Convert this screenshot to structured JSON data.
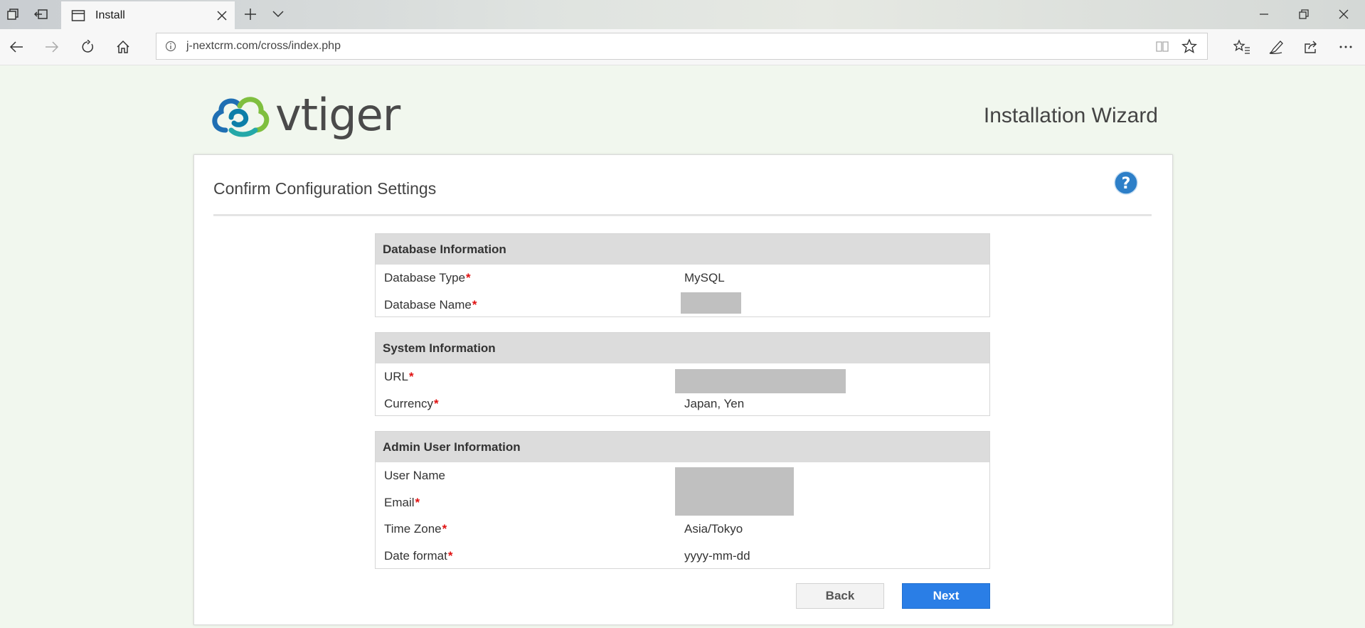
{
  "browser": {
    "tab_title": "Install",
    "address_url": "j-nextcrm.com/cross/index.php"
  },
  "header": {
    "logo_text": "vtiger",
    "wizard_title": "Installation Wizard"
  },
  "card": {
    "title": "Confirm Configuration Settings"
  },
  "sections": {
    "database": {
      "title": "Database Information",
      "rows": [
        {
          "label": "Database Type",
          "required": "*",
          "value": "MySQL"
        },
        {
          "label": "Database Name",
          "required": "*",
          "value": ""
        }
      ]
    },
    "system": {
      "title": "System Information",
      "rows": [
        {
          "label": "URL",
          "required": "*",
          "value": ""
        },
        {
          "label": "Currency",
          "required": "*",
          "value": "Japan, Yen"
        }
      ]
    },
    "admin": {
      "title": "Admin User Information",
      "rows": [
        {
          "label": "User Name",
          "required": "",
          "value": ""
        },
        {
          "label": "Email",
          "required": "*",
          "value": ""
        },
        {
          "label": "Time Zone",
          "required": "*",
          "value": "Asia/Tokyo"
        },
        {
          "label": "Date format",
          "required": "*",
          "value": "yyyy-mm-dd"
        }
      ]
    }
  },
  "buttons": {
    "back": "Back",
    "next": "Next"
  },
  "colors": {
    "page_bg": "#f1f7ee",
    "section_header_bg": "#dcdcdc",
    "required": "#e01010",
    "primary": "#2a7ee6",
    "help_icon": "#2d7fc8"
  },
  "icons": [
    "tab-manager-icon",
    "set-aside-tabs-icon",
    "tab-page-icon",
    "close-tab-icon",
    "new-tab-icon",
    "tab-dropdown-icon",
    "minimize-icon",
    "restore-icon",
    "close-window-icon",
    "back-icon",
    "forward-icon",
    "refresh-icon",
    "home-icon",
    "site-info-icon",
    "reading-view-icon",
    "favorite-star-icon",
    "favorites-hub-icon",
    "notes-pen-icon",
    "share-icon",
    "more-icon",
    "help-icon"
  ]
}
